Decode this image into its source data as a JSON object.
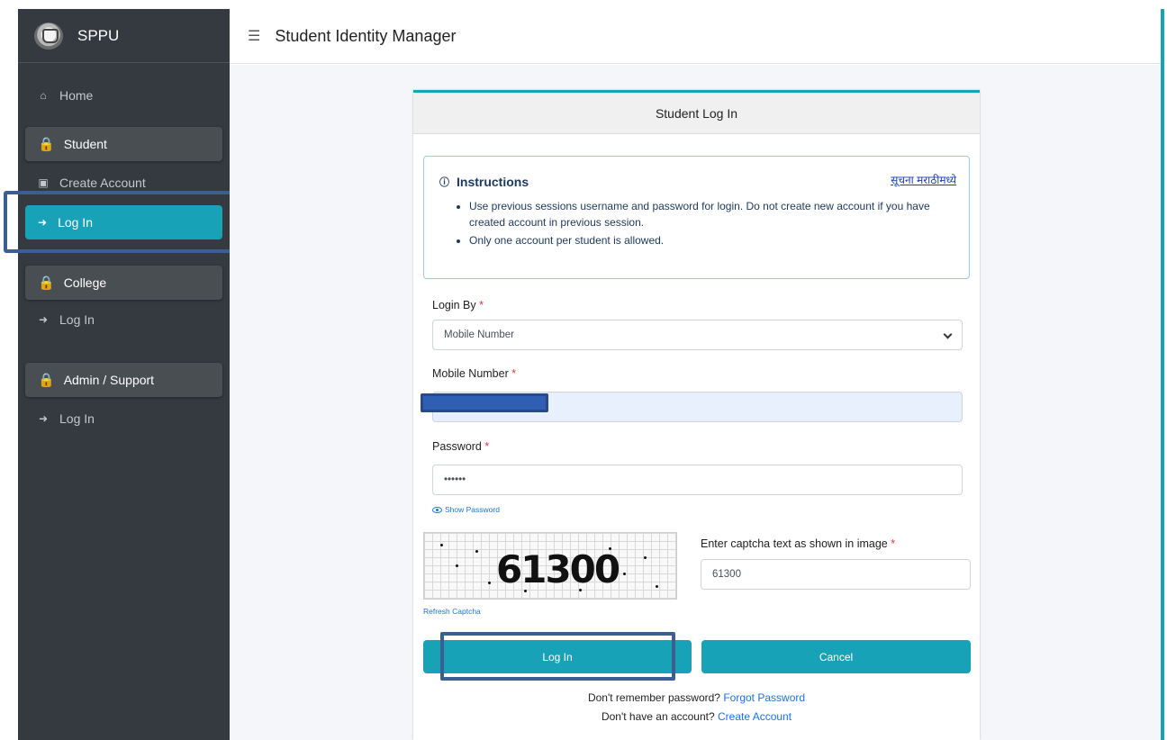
{
  "sidebar": {
    "brand": "SPPU",
    "home": "Home",
    "student_header": "Student",
    "create_account": "Create Account",
    "student_login": "Log In",
    "college_header": "College",
    "college_login": "Log In",
    "admin_header": "Admin / Support",
    "admin_login": "Log In"
  },
  "header": {
    "title": "Student Identity Manager"
  },
  "card": {
    "title": "Student Log In",
    "instructions": {
      "heading": "Instructions",
      "marathi_link": "सूचना मराठीमध्ये",
      "items": [
        "Use previous sessions username and password for login. Do not create new account if you have created account in previous session.",
        "Only one account per student is allowed."
      ]
    },
    "login_by": {
      "label": "Login By",
      "required": "*",
      "selected": "Mobile Number"
    },
    "mobile": {
      "label": "Mobile Number",
      "required": "*",
      "value": ""
    },
    "password": {
      "label": "Password",
      "required": "*",
      "value": "••••••",
      "show_password": "Show Password"
    },
    "captcha": {
      "image_text": "61300",
      "refresh": "Refresh Captcha",
      "label": "Enter captcha text as shown in image",
      "required": "*",
      "value": "61300"
    },
    "buttons": {
      "login": "Log In",
      "cancel": "Cancel"
    },
    "footer": {
      "forgot_prompt": "Don't remember password?",
      "forgot_link": "Forgot Password",
      "create_prompt": "Don't have an account?",
      "create_link": "Create Account"
    }
  },
  "colors": {
    "sidebar_bg": "#343a40",
    "accent": "#17a2b8",
    "highlight_box": "#3a5f92"
  }
}
